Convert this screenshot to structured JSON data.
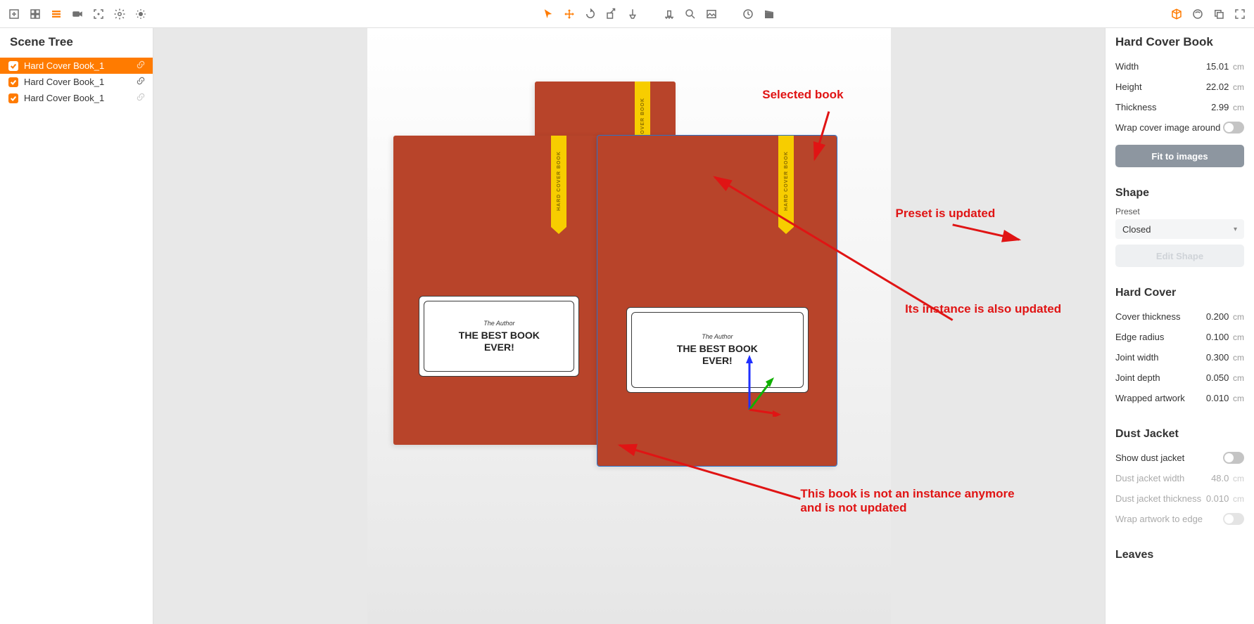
{
  "left": {
    "title": "Scene Tree",
    "items": [
      {
        "label": "Hard Cover Book_1",
        "selected": true,
        "linked": true
      },
      {
        "label": "Hard Cover Book_1",
        "selected": false,
        "linked": true
      },
      {
        "label": "Hard Cover Book_1",
        "selected": false,
        "linked": false
      }
    ]
  },
  "viewport": {
    "book_author": "The Author",
    "book_title_l1": "THE BEST BOOK",
    "book_title_l2": "EVER!",
    "bookmark_text": "HARD COVER BOOK"
  },
  "annotations": {
    "selected": "Selected book",
    "preset_updated": "Preset is updated",
    "instance_updated": "Its instance is also updated",
    "not_instance_l1": "This book is not an instance anymore",
    "not_instance_l2": "and is not updated"
  },
  "panel": {
    "title": "Hard Cover Book",
    "dims": {
      "width_label": "Width",
      "width_val": "15.01",
      "height_label": "Height",
      "height_val": "22.02",
      "thickness_label": "Thickness",
      "thickness_val": "2.99",
      "unit": "cm",
      "wrap_label": "Wrap cover image around"
    },
    "fit_button": "Fit to images",
    "shape": {
      "heading": "Shape",
      "preset_label": "Preset",
      "preset_value": "Closed",
      "edit_button": "Edit Shape"
    },
    "hardcover": {
      "heading": "Hard Cover",
      "rows": [
        {
          "label": "Cover thickness",
          "val": "0.200"
        },
        {
          "label": "Edge radius",
          "val": "0.100"
        },
        {
          "label": "Joint width",
          "val": "0.300"
        },
        {
          "label": "Joint depth",
          "val": "0.050"
        },
        {
          "label": "Wrapped artwork",
          "val": "0.010"
        }
      ]
    },
    "dustjacket": {
      "heading": "Dust Jacket",
      "show_label": "Show dust jacket",
      "rows": [
        {
          "label": "Dust jacket width",
          "val": "48.0"
        },
        {
          "label": "Dust jacket thickness",
          "val": "0.010"
        }
      ],
      "wrap_label": "Wrap artwork to edge"
    },
    "leaves_heading": "Leaves"
  }
}
